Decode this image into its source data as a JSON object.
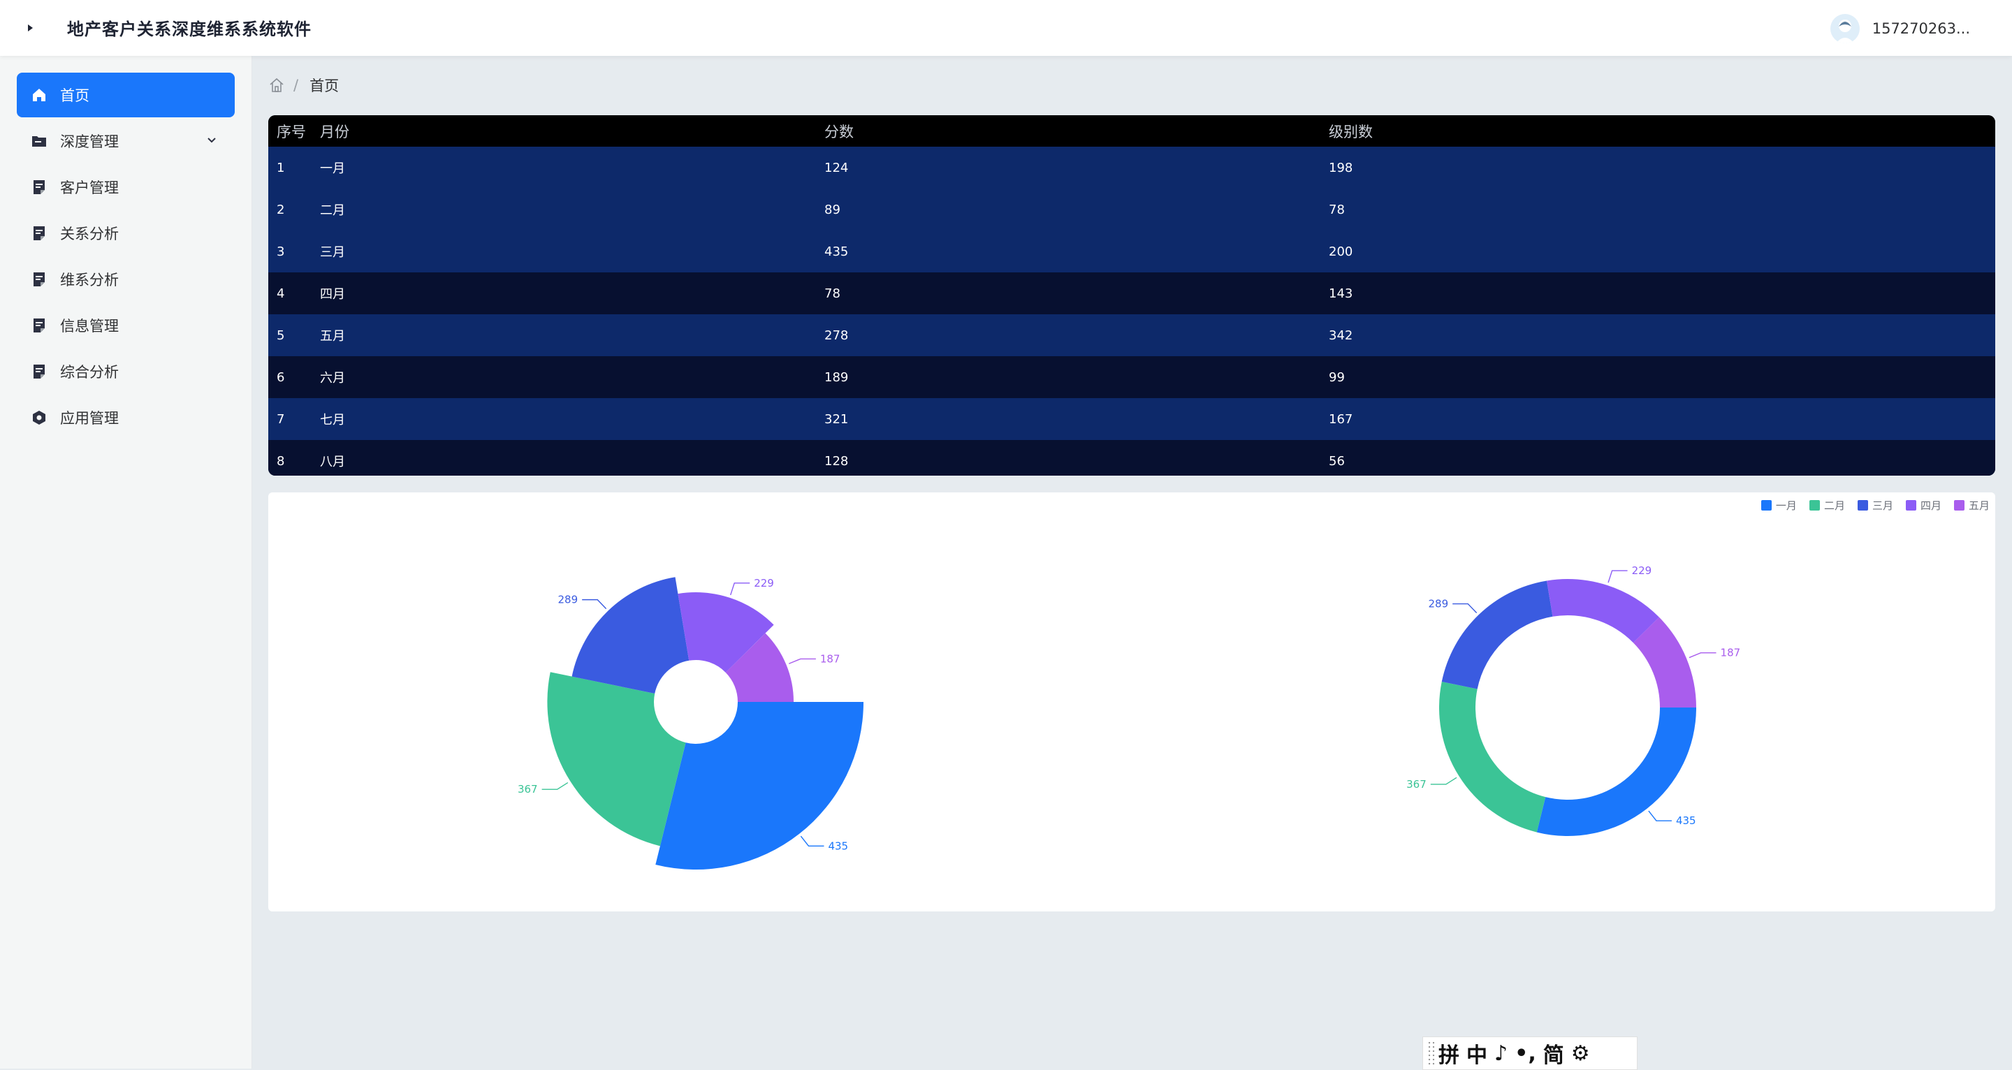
{
  "header": {
    "app_title": "地产客户关系深度维系系统软件",
    "username": "157270263..."
  },
  "sidebar": {
    "items": [
      {
        "label": "首页",
        "icon": "home-icon",
        "active": true
      },
      {
        "label": "深度管理",
        "icon": "folder-icon",
        "has_submenu": true
      },
      {
        "label": "客户管理",
        "icon": "document-icon"
      },
      {
        "label": "关系分析",
        "icon": "document-icon"
      },
      {
        "label": "维系分析",
        "icon": "document-icon"
      },
      {
        "label": "信息管理",
        "icon": "document-icon"
      },
      {
        "label": "综合分析",
        "icon": "document-icon"
      },
      {
        "label": "应用管理",
        "icon": "hexagon-icon"
      }
    ]
  },
  "breadcrumb": {
    "current": "首页",
    "separator": "/"
  },
  "table": {
    "headers": [
      "序号",
      "月份",
      "分数",
      "级别数"
    ],
    "rows": [
      [
        "1",
        "一月",
        "124",
        "198"
      ],
      [
        "2",
        "二月",
        "89",
        "78"
      ],
      [
        "3",
        "三月",
        "435",
        "200"
      ],
      [
        "4",
        "四月",
        "78",
        "143"
      ],
      [
        "5",
        "五月",
        "278",
        "342"
      ],
      [
        "6",
        "六月",
        "189",
        "99"
      ],
      [
        "7",
        "七月",
        "321",
        "167"
      ],
      [
        "8",
        "八月",
        "128",
        "56"
      ]
    ]
  },
  "chart_data": {
    "legend": [
      "一月",
      "二月",
      "三月",
      "四月",
      "五月"
    ],
    "colors": [
      "#1a77fb",
      "#3bc496",
      "#3a5be0",
      "#8b5cf6",
      "#a95ded"
    ],
    "charts": [
      {
        "type": "pie",
        "variant": "rose",
        "slices": [
          {
            "name": "一月",
            "value": 435
          },
          {
            "name": "二月",
            "value": 367
          },
          {
            "name": "三月",
            "value": 289
          },
          {
            "name": "四月",
            "value": 229
          },
          {
            "name": "五月",
            "value": 187
          }
        ]
      },
      {
        "type": "pie",
        "variant": "donut",
        "slices": [
          {
            "name": "一月",
            "value": 435
          },
          {
            "name": "二月",
            "value": 367
          },
          {
            "name": "三月",
            "value": 289
          },
          {
            "name": "四月",
            "value": 229
          },
          {
            "name": "五月",
            "value": 187
          }
        ]
      }
    ]
  },
  "ime_toolbar": {
    "items": [
      "拼",
      "中",
      "♪",
      "•,",
      "简",
      "⚙"
    ]
  }
}
